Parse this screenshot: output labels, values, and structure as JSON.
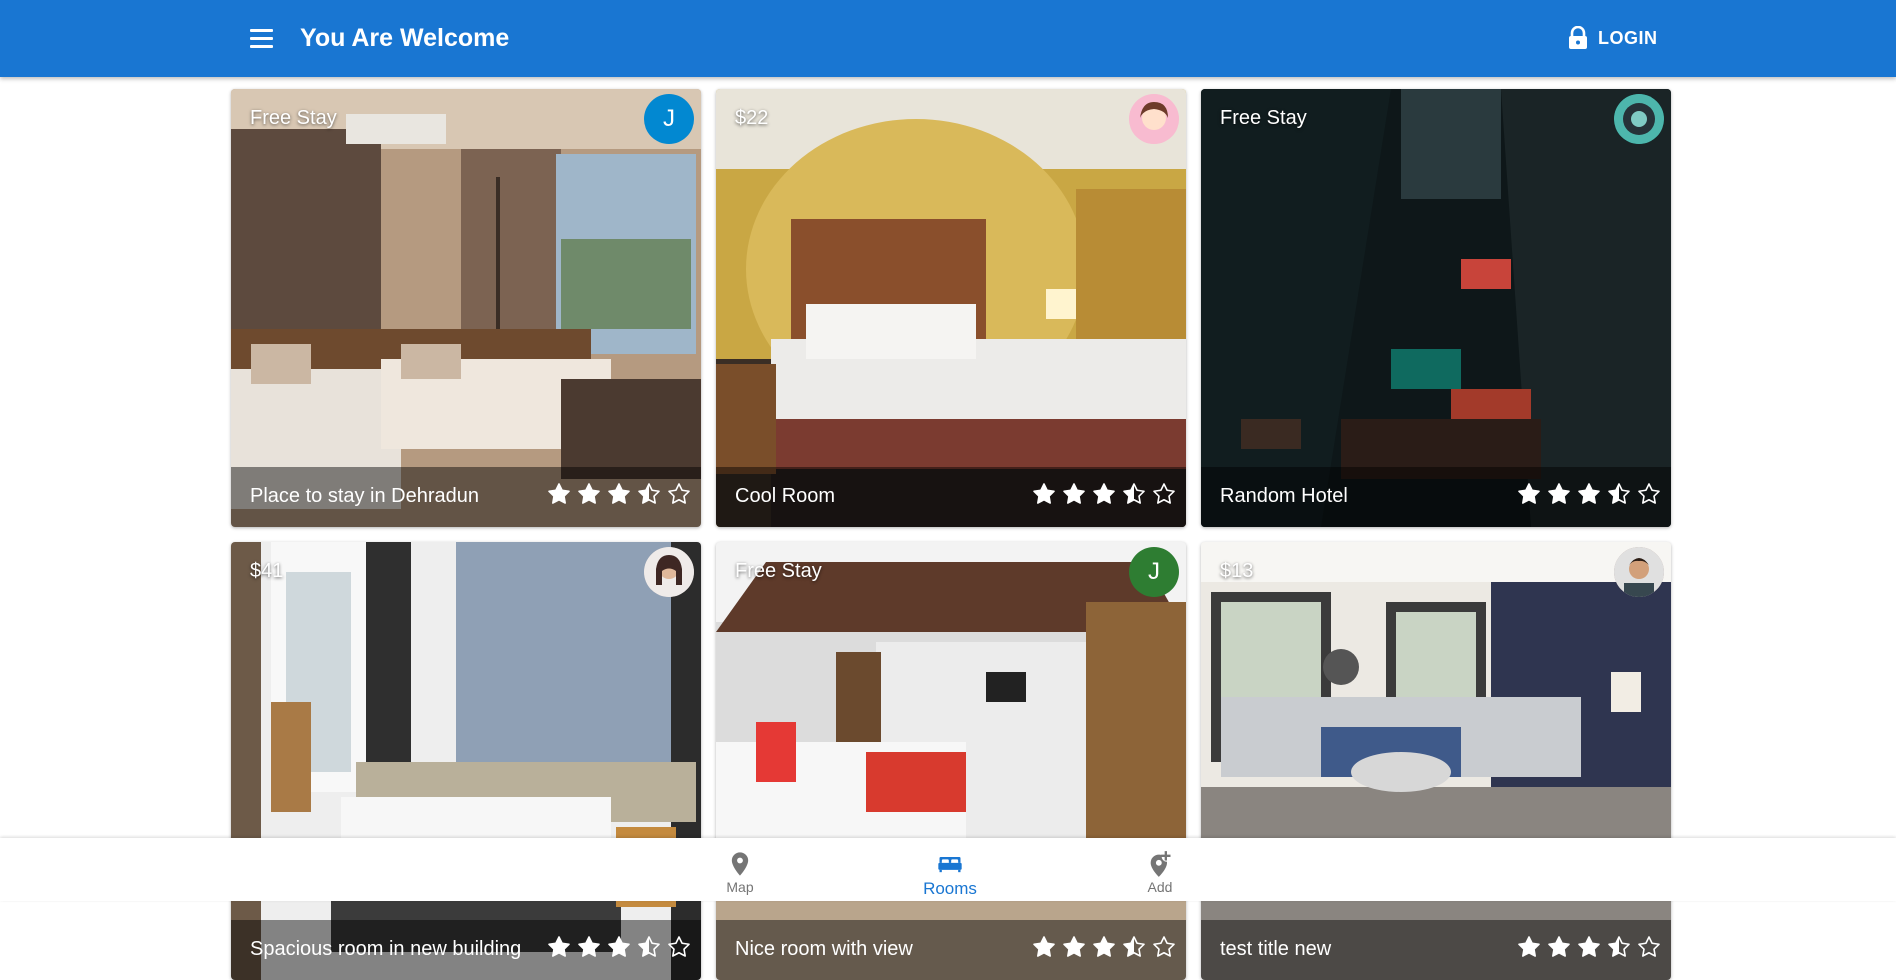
{
  "appbar": {
    "title": "You Are Welcome",
    "login_label": "LOGIN",
    "background": "#1976d2"
  },
  "rooms": [
    {
      "price": "Free Stay",
      "title": "Place to stay in Dehradun",
      "rating": 3.5,
      "avatar_letter": "J",
      "avatar_color": "#0288d1"
    },
    {
      "price": "$22",
      "title": "Cool Room",
      "rating": 3.5,
      "avatar_letter": "",
      "avatar_color": "#f8bbd0"
    },
    {
      "price": "Free Stay",
      "title": "Random Hotel",
      "rating": 3.5,
      "avatar_letter": "",
      "avatar_color": "#26a69a"
    },
    {
      "price": "$41",
      "title": "Spacious room in new building",
      "rating": 3.5,
      "avatar_letter": "",
      "avatar_color": "#d7ccc8"
    },
    {
      "price": "Free Stay",
      "title": "Nice room with view",
      "rating": 3.5,
      "avatar_letter": "J",
      "avatar_color": "#2e7d32"
    },
    {
      "price": "$13",
      "title": "test title new",
      "rating": 3.5,
      "avatar_letter": "",
      "avatar_color": "#bcaaa4"
    }
  ],
  "bottom_nav": {
    "items": [
      {
        "label": "Map",
        "icon": "map-pin-icon"
      },
      {
        "label": "Rooms",
        "icon": "bed-icon"
      },
      {
        "label": "Add",
        "icon": "add-location-icon"
      }
    ],
    "active": "Rooms"
  }
}
